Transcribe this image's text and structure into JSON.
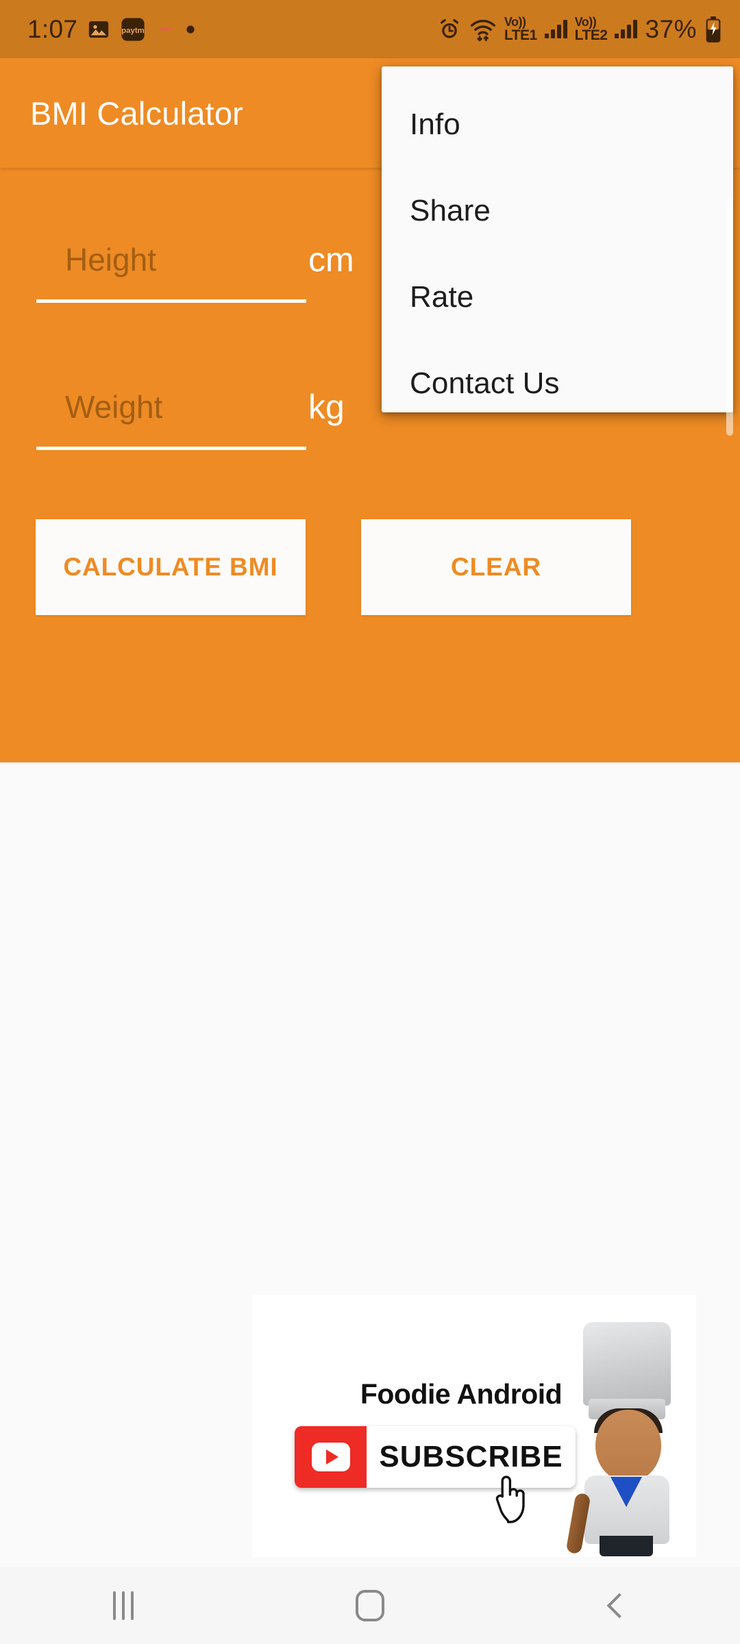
{
  "status_bar": {
    "clock": "1:07",
    "notification_icons": [
      "gallery-icon",
      "paytm-icon",
      "app-icon",
      "dot-icon"
    ],
    "alarm_icon": "alarm-icon",
    "wifi_icon": "wifi-icon",
    "sim1": {
      "volte_top": "Vo))",
      "volte_bottom": "LTE1",
      "signal": "signal-bars-icon"
    },
    "sim2": {
      "volte_top": "Vo))",
      "volte_bottom": "LTE2",
      "signal": "signal-bars-icon"
    },
    "battery_percent": "37%",
    "battery_icon": "battery-charging-icon"
  },
  "app_bar": {
    "title": "BMI Calculator",
    "overflow_icon": "overflow-menu-icon"
  },
  "overflow_menu": {
    "items": [
      {
        "label": "Info"
      },
      {
        "label": "Share"
      },
      {
        "label": "Rate"
      },
      {
        "label": "Contact Us"
      }
    ]
  },
  "form": {
    "height": {
      "placeholder": "Height",
      "value": "",
      "unit": "cm"
    },
    "weight": {
      "placeholder": "Weight",
      "value": "",
      "unit": "kg"
    }
  },
  "buttons": {
    "calculate": "CALCULATE BMI",
    "clear": "CLEAR"
  },
  "ad": {
    "brand": "Foodie Android",
    "subscribe_label": "SUBSCRIBE",
    "youtube_icon": "youtube-play-icon",
    "cursor_icon": "hand-cursor-icon",
    "mascot": "chef-mascot-image"
  },
  "nav_bar": {
    "recents": "recents-icon",
    "home": "home-icon",
    "back": "back-icon"
  },
  "colors": {
    "primary_orange": "#EE8B24",
    "status_bar_orange": "#CC7A1E",
    "button_text": "#EE8B24",
    "placeholder": "#A35E13",
    "surface": "#FAFAFA",
    "youtube_red": "#EE2B25"
  }
}
